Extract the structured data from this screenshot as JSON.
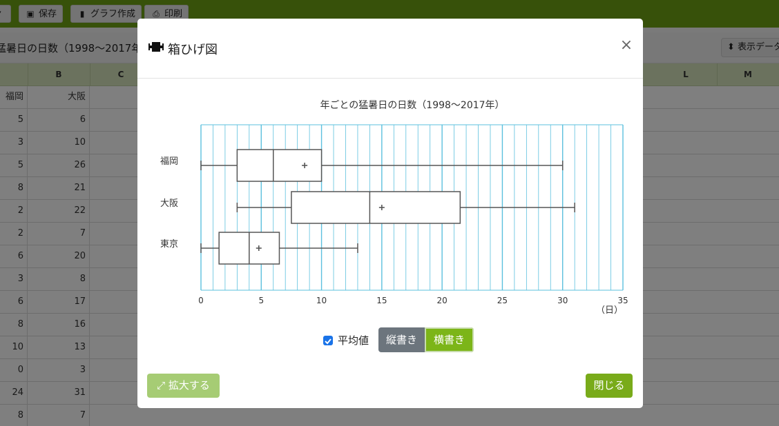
{
  "toolbar": {
    "save_label": "保存",
    "chart_label": "グラフ作成",
    "print_label": "印刷"
  },
  "sheet": {
    "title": "猛暑日の日数（1998〜2017年）",
    "view_button": "表示データ",
    "columns": [
      "B",
      "C",
      "L",
      "M"
    ],
    "row_headers": [
      "福岡",
      "大阪",
      "東"
    ],
    "rows": [
      [
        "5",
        "6"
      ],
      [
        "3",
        "10"
      ],
      [
        "5",
        "26"
      ],
      [
        "8",
        "21"
      ],
      [
        "2",
        "22"
      ],
      [
        "2",
        "7"
      ],
      [
        "6",
        "20"
      ],
      [
        "3",
        "8"
      ],
      [
        "6",
        "17"
      ],
      [
        "8",
        "16"
      ],
      [
        "10",
        "13"
      ],
      [
        "0",
        "3"
      ],
      [
        "24",
        "31"
      ],
      [
        "8",
        "7"
      ]
    ]
  },
  "modal": {
    "title": "箱ひげ図",
    "close_symbol": "×",
    "mean_label": "平均値",
    "mean_checked": true,
    "vertical_label": "縦書き",
    "horizontal_label": "横書き",
    "expand_label": "拡大する",
    "close_label": "閉じる"
  },
  "chart_data": {
    "type": "boxplot",
    "orientation": "horizontal",
    "title": "年ごとの猛暑日の日数（1998〜2017年）",
    "xlabel": "（日）",
    "xlim": [
      0,
      35
    ],
    "xticks": [
      0,
      5,
      10,
      15,
      20,
      25,
      30,
      35
    ],
    "grid_step": 1,
    "series": [
      {
        "name": "福岡",
        "min": 0,
        "q1": 3,
        "median": 6,
        "q3": 10,
        "max": 30,
        "mean": 8.6
      },
      {
        "name": "大阪",
        "min": 3,
        "q1": 7.5,
        "median": 14,
        "q3": 21.5,
        "max": 31,
        "mean": 15
      },
      {
        "name": "東京",
        "min": 0,
        "q1": 1.5,
        "median": 4,
        "q3": 6.5,
        "max": 13,
        "mean": 4.8
      }
    ],
    "colors": {
      "grid": "#5bc0de",
      "box": "#555555"
    }
  }
}
